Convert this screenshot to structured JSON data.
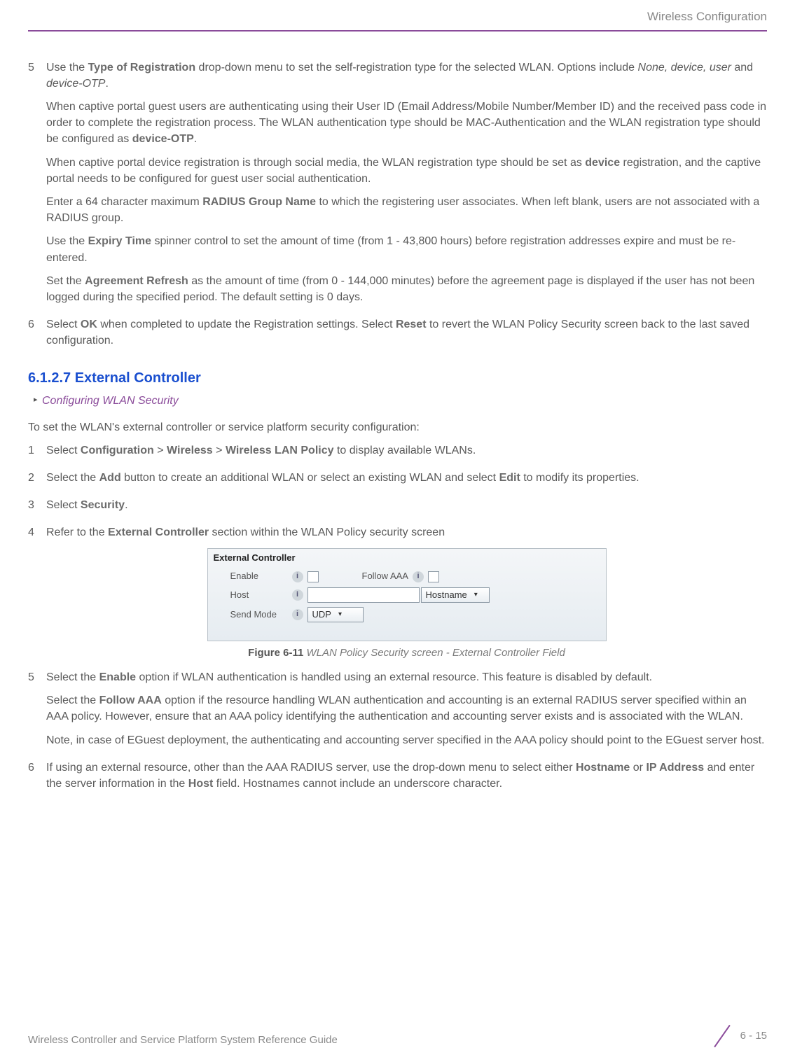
{
  "header": {
    "title": "Wireless Configuration"
  },
  "section_a": {
    "step5_num": "5",
    "step5_lead_a": "Use the ",
    "step5_bold_a": "Type of Registration",
    "step5_lead_b": " drop-down menu to set the self-registration type for the selected WLAN. Options include ",
    "step5_italic_a": "None, device, user",
    "step5_lead_c": " and ",
    "step5_italic_b": "device-OTP",
    "step5_lead_d": ".",
    "p2_a": "When captive portal guest users are authenticating using their User ID (Email Address/Mobile Number/Member ID) and the received pass code in order to complete the registration process. The WLAN authentication type should be MAC-Authentication and the WLAN registration type should be configured as ",
    "p2_bold": "device-OTP",
    "p2_b": ".",
    "p3_a": "When captive portal device registration is through social media, the WLAN registration type should be set as ",
    "p3_bold": "device",
    "p3_b": " registration, and the captive portal needs to be configured for guest user social authentication.",
    "p4_a": "Enter a 64 character maximum ",
    "p4_bold": "RADIUS Group Name",
    "p4_b": " to which the registering user associates. When left blank, users are not associated with a RADIUS group.",
    "p5_a": "Use the ",
    "p5_bold": "Expiry Time",
    "p5_b": " spinner control to set the amount of time (from 1 - 43,800 hours) before registration addresses expire and must be re-entered.",
    "p6_a": "Set the ",
    "p6_bold": "Agreement Refresh",
    "p6_b": " as the amount of time (from 0 - 144,000 minutes) before the agreement page is displayed if the user has not been logged during the specified period. The default setting is 0 days.",
    "step6_num": "6",
    "step6_a": "Select ",
    "step6_b1": "OK",
    "step6_b": " when completed to update the Registration settings. Select ",
    "step6_b2": "Reset",
    "step6_c": " to revert the WLAN Policy Security screen back to the last saved configuration."
  },
  "heading": "6.1.2.7 External Controller",
  "breadcrumb": "Configuring WLAN Security",
  "intro": "To set the WLAN's external controller or service platform security configuration:",
  "section_b": {
    "s1_num": "1",
    "s1_a": "Select ",
    "s1_b1": "Configuration",
    "s1_g1": " > ",
    "s1_b2": "Wireless",
    "s1_g2": " > ",
    "s1_b3": "Wireless LAN Policy",
    "s1_c": " to display available WLANs.",
    "s2_num": "2",
    "s2_a": "Select the ",
    "s2_b1": "Add",
    "s2_b": " button to create an additional WLAN or select an existing WLAN and select ",
    "s2_b2": "Edit",
    "s2_c": " to modify its properties.",
    "s3_num": "3",
    "s3_a": "Select ",
    "s3_b1": "Security",
    "s3_b": ".",
    "s4_num": "4",
    "s4_a": "Refer to the ",
    "s4_b1": "External Controller",
    "s4_b": " section within the WLAN Policy security screen"
  },
  "figure": {
    "fieldset_title": "External Controller",
    "enable_label": "Enable",
    "follow_aaa_label": "Follow AAA",
    "host_label": "Host",
    "hostname_dd": "Hostname",
    "sendmode_label": "Send Mode",
    "udp_dd": "UDP",
    "caption_bold": "Figure 6-11",
    "caption_italic": "  WLAN Policy Security screen - External Controller Field"
  },
  "section_c": {
    "s5_num": "5",
    "s5_a": "Select the ",
    "s5_b1": "Enable",
    "s5_b": " option if WLAN authentication is handled using an external resource. This feature is disabled by default.",
    "s5p2_a": "Select the ",
    "s5p2_b1": "Follow AAA",
    "s5p2_b": " option if the resource handling WLAN authentication and accounting is an external RADIUS server specified within an AAA policy. However, ensure that an AAA policy identifying the authentication and accounting server exists and is associated with the WLAN.",
    "s5p3": "Note, in case of EGuest deployment, the authenticating and accounting server specified in the AAA policy should point to the EGuest server host.",
    "s6_num": "6",
    "s6_a": "If using an external resource, other than the AAA RADIUS server, use the drop-down menu to select either ",
    "s6_b1": "Hostname",
    "s6_m": " or ",
    "s6_b2": "IP Address",
    "s6_b": " and enter the server information in the ",
    "s6_b3": "Host",
    "s6_c": " field. Hostnames cannot include an underscore character."
  },
  "footer": {
    "left": "Wireless Controller and Service Platform System Reference Guide",
    "right": "6 - 15"
  }
}
